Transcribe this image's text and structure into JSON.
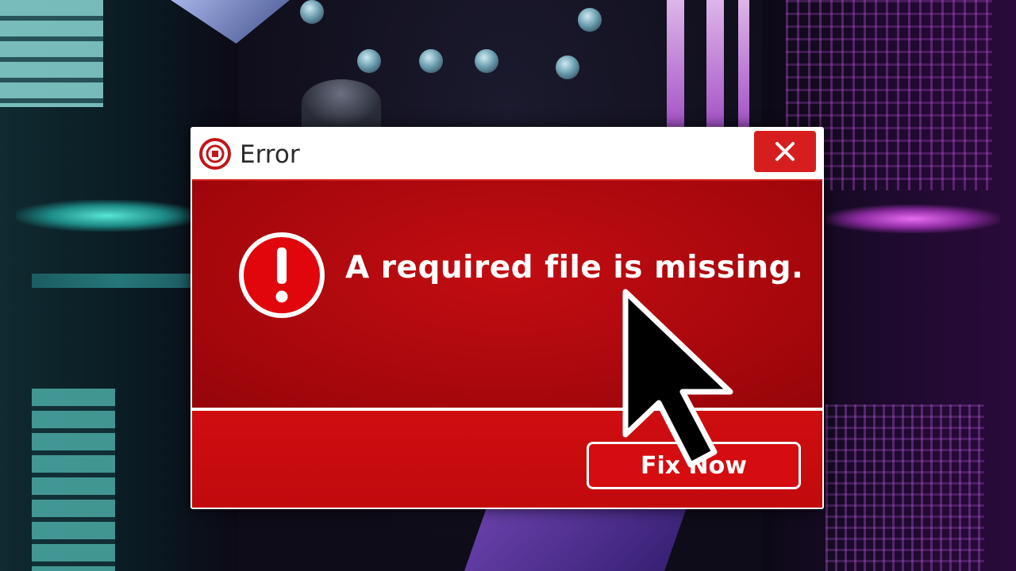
{
  "window": {
    "title": "Error"
  },
  "dialog": {
    "message": "A required file is missing.",
    "primary_button_label": "Fix Now"
  },
  "icons": {
    "title_icon": "circle-logo-icon",
    "close_icon": "close-icon",
    "alert_icon": "exclamation-circle-icon",
    "pointer": "mouse-pointer-icon"
  },
  "colors": {
    "dialog_red": "#c20d12",
    "title_bar": "#ffffff",
    "close_button": "#d71e1e",
    "text_light": "#ffffff"
  }
}
